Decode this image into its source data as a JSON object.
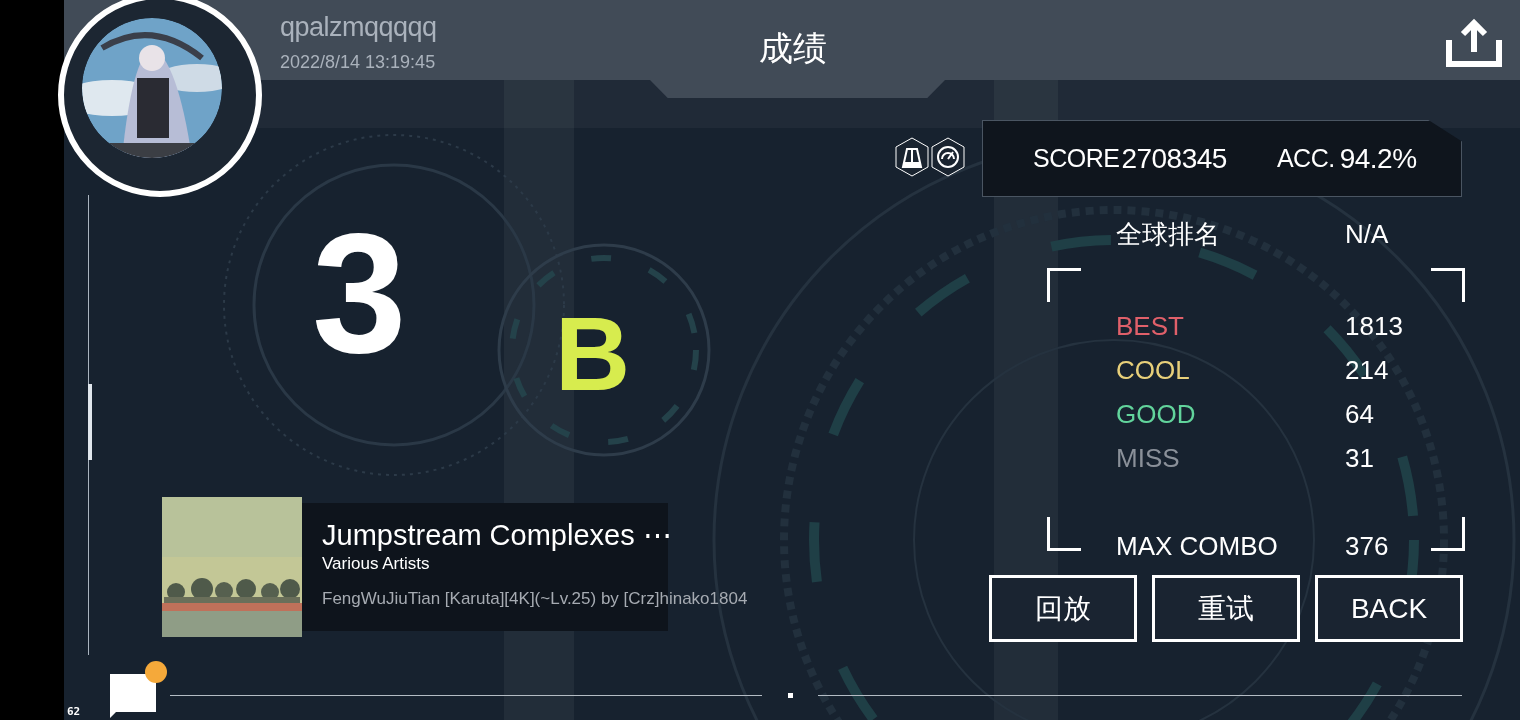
{
  "player": {
    "name": "qpalzmqqqqq",
    "timestamp": "2022/8/14 13:19:45"
  },
  "title": "成绩",
  "rank": {
    "number": "3",
    "grade": "B"
  },
  "modifiers": [
    {
      "kind": "metronome"
    },
    {
      "kind": "speed"
    }
  ],
  "score": {
    "label": "SCORE",
    "value": "2708345",
    "acc_label": "ACC.",
    "acc_value": "94.2%"
  },
  "global_rank": {
    "label": "全球排名",
    "value": "N/A"
  },
  "judgements": [
    {
      "label": "BEST",
      "value": "1813",
      "color": "#e0606a"
    },
    {
      "label": "COOL",
      "value": "214",
      "color": "#e8d07a"
    },
    {
      "label": "GOOD",
      "value": "64",
      "color": "#62d49c"
    },
    {
      "label": "MISS",
      "value": "31",
      "color": "#8a9099"
    }
  ],
  "max_combo": {
    "label": "MAX COMBO",
    "value": "376"
  },
  "buttons": [
    {
      "label": "回放"
    },
    {
      "label": "重试"
    },
    {
      "label": "BACK"
    }
  ],
  "song": {
    "title": "Jumpstream Complexes ⋯",
    "artist": "Various Artists",
    "chart": "FengWuJiuTian [Karuta][4K](~Lv.25) by [Crz]hinako1804"
  },
  "chat": {
    "unread": true
  },
  "fps": "62"
}
